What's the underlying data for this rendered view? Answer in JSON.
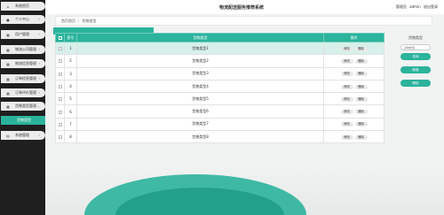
{
  "header": {
    "title": "物流配送服务推荐系统",
    "user_role": "管理员",
    "username": "admin",
    "logout": "退出登录"
  },
  "sidebar": {
    "items": [
      {
        "label": "系统首页",
        "icon": "home-icon",
        "glyph": "⌂"
      },
      {
        "label": "个人中心",
        "icon": "user-icon",
        "glyph": "●"
      },
      {
        "label": "用户管理",
        "icon": "grid-icon",
        "glyph": "▦"
      },
      {
        "label": "物流公司管理",
        "icon": "grid-icon",
        "glyph": "▦"
      },
      {
        "label": "物流信息管理",
        "icon": "grid-icon",
        "glyph": "▦"
      },
      {
        "label": "订单信息管理",
        "icon": "grid-icon",
        "glyph": "▦"
      },
      {
        "label": "订单评价管理",
        "icon": "grid-icon",
        "glyph": "▦"
      },
      {
        "label": "货物类型管理",
        "icon": "grid-icon",
        "glyph": "▦"
      },
      {
        "label": "货物类型",
        "icon": "",
        "glyph": ""
      },
      {
        "label": "系统管理",
        "icon": "settings-icon",
        "glyph": "▤"
      }
    ]
  },
  "breadcrumb": {
    "home": "首页首页",
    "separator": "|",
    "current": "货物类型"
  },
  "table": {
    "columns": [
      "",
      "索引",
      "货物类型",
      "操作"
    ],
    "rows": [
      {
        "index": "1",
        "type": "货物类型1"
      },
      {
        "index": "2",
        "type": "货物类型2"
      },
      {
        "index": "3",
        "type": "货物类型3"
      },
      {
        "index": "4",
        "type": "货物类型4"
      },
      {
        "index": "5",
        "type": "货物类型5"
      },
      {
        "index": "6",
        "type": "货物类型6"
      },
      {
        "index": "7",
        "type": "货物类型7"
      },
      {
        "index": "8",
        "type": "货物类型8"
      }
    ],
    "edit_label": "修改",
    "delete_label": "删除"
  },
  "search_panel": {
    "label": "货物类型",
    "placeholder": "货物类型",
    "search_button": "查询",
    "add_button": "新增",
    "delete_button": "删除"
  },
  "colors": {
    "accent": "#2bb39c",
    "sidebar_bg": "#1f1f1f"
  }
}
